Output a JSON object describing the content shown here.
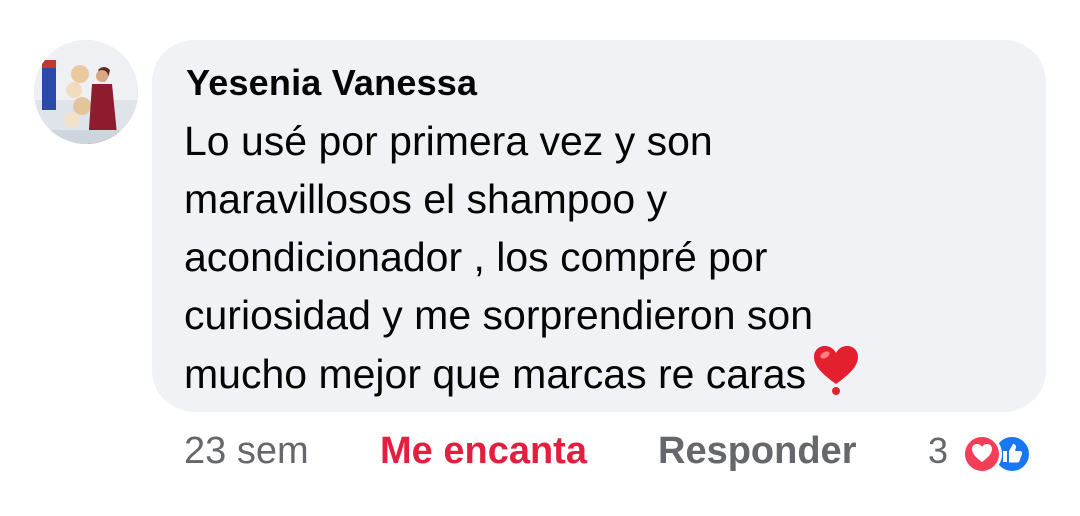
{
  "comment": {
    "author": "Yesenia Vanessa",
    "text_lines": [
      "Lo usé por primera vez y son",
      "maravillosos el shampoo y",
      "acondicionador , los compré por",
      "curiosidad y me sorprendieron son",
      "mucho mejor que marcas re caras"
    ],
    "emoji": "red-heart-icon",
    "avatar": "profile-photo-avatar"
  },
  "actions": {
    "time": "23 sem",
    "love_label": "Me encanta",
    "reply_label": "Responder"
  },
  "reactions": {
    "count": "3",
    "icons": [
      "love-reaction-icon",
      "like-reaction-icon"
    ]
  },
  "colors": {
    "bubble_bg": "#f0f2f5",
    "text": "#050505",
    "muted": "#65676b",
    "love": "#e41e3f",
    "like": "#1877f2"
  }
}
